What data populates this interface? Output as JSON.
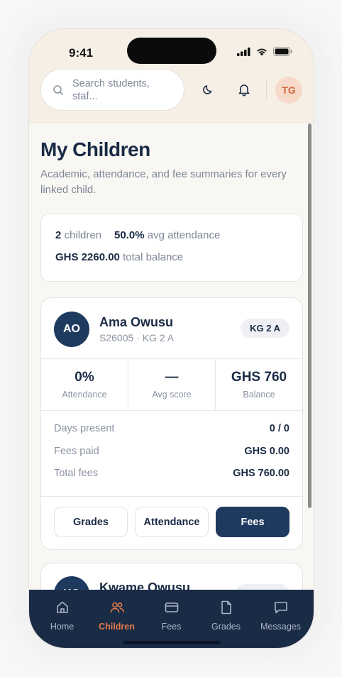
{
  "status": {
    "time": "9:41"
  },
  "header": {
    "search_placeholder": "Search students, staf...",
    "avatar_initials": "TG"
  },
  "page": {
    "title": "My Children",
    "subtitle": "Academic, attendance, and fee summaries for every linked child."
  },
  "summary": {
    "children_count": "2",
    "children_label": "children",
    "avg_attendance": "50.0%",
    "avg_attendance_label": "avg attendance",
    "total_balance": "GHS 2260.00",
    "total_balance_label": "total balance"
  },
  "children": [
    {
      "initials": "AO",
      "name": "Ama Owusu",
      "meta": "S26005 · KG 2 A",
      "class_badge": "KG 2 A",
      "stats": [
        {
          "value": "0%",
          "label": "Attendance"
        },
        {
          "value": "—",
          "label": "Avg score"
        },
        {
          "value": "GHS 760",
          "label": "Balance"
        }
      ],
      "details": [
        {
          "label": "Days present",
          "value": "0 / 0"
        },
        {
          "label": "Fees paid",
          "value": "GHS 0.00"
        },
        {
          "label": "Total fees",
          "value": "GHS 760.00"
        }
      ],
      "actions": {
        "grades": "Grades",
        "attendance": "Attendance",
        "fees": "Fees"
      }
    },
    {
      "initials": "KO",
      "name": "Kwame Owusu"
    }
  ],
  "tabbar": {
    "items": [
      {
        "label": "Home",
        "icon": "home-icon"
      },
      {
        "label": "Children",
        "icon": "children-icon",
        "active": true
      },
      {
        "label": "Fees",
        "icon": "card-icon"
      },
      {
        "label": "Grades",
        "icon": "document-icon"
      },
      {
        "label": "Messages",
        "icon": "message-icon"
      }
    ]
  },
  "colors": {
    "navy": "#1a2b45",
    "accent": "#e57a4c",
    "avatar_bg": "#1f3a5f"
  }
}
